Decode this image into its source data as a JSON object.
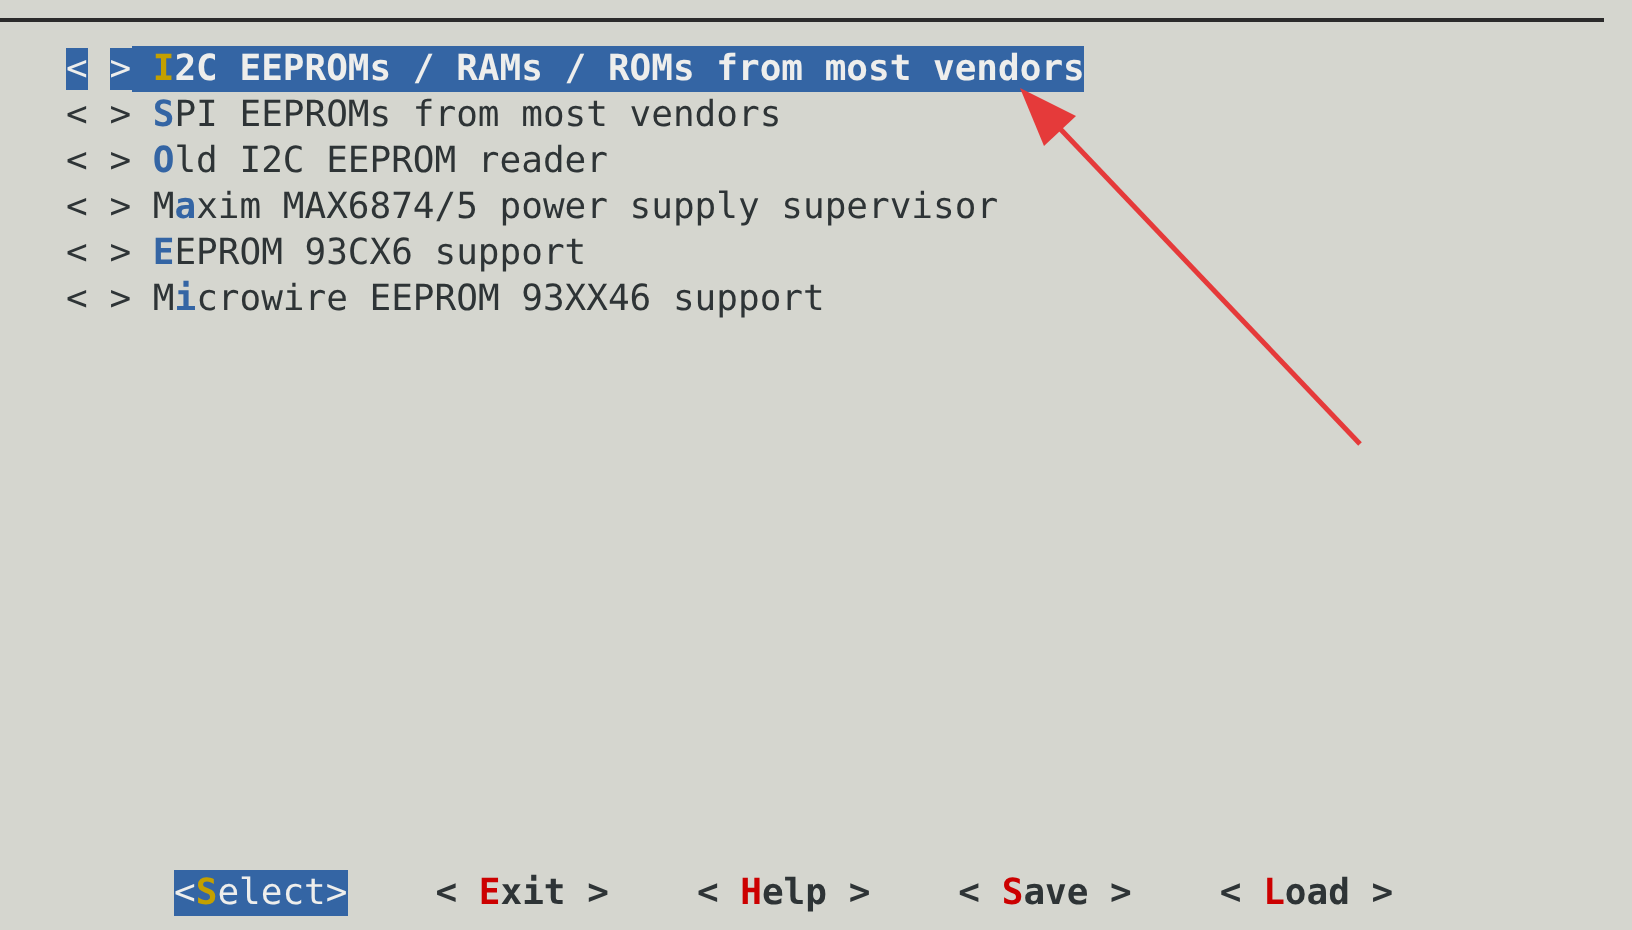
{
  "items": [
    {
      "checkbox": "< >",
      "hotkey": "I",
      "rest": "2C EEPROMs / RAMs / ROMs from most vendors",
      "selected": true
    },
    {
      "checkbox": "< >",
      "hotkey": "S",
      "rest": "PI EEPROMs from most vendors",
      "selected": false
    },
    {
      "checkbox": "< >",
      "hotkey": "O",
      "rest": "ld I2C EEPROM reader",
      "selected": false
    },
    {
      "checkbox": "< >",
      "lead": "M",
      "hotkey": "a",
      "rest": "xim MAX6874/5 power supply supervisor",
      "selected": false
    },
    {
      "checkbox": "< >",
      "hotkey": "E",
      "rest": "EPROM 93CX6 support",
      "selected": false
    },
    {
      "checkbox": "< >",
      "lead": "M",
      "hotkey": "i",
      "rest": "crowire EEPROM 93XX46 support",
      "selected": false
    }
  ],
  "buttons": [
    {
      "lead": "<",
      "hotkey": "S",
      "rest": "elect>",
      "selected": true
    },
    {
      "lead": "< ",
      "hotkey": "E",
      "rest": "xit >",
      "selected": false
    },
    {
      "lead": "< ",
      "hotkey": "H",
      "rest": "elp >",
      "selected": false
    },
    {
      "lead": "< ",
      "hotkey": "S",
      "rest": "ave >",
      "selected": false
    },
    {
      "lead": "< ",
      "hotkey": "L",
      "rest": "oad >",
      "selected": false
    }
  ]
}
